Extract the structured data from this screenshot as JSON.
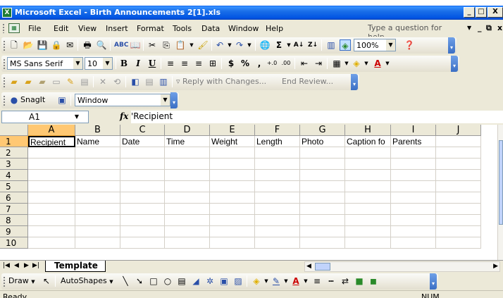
{
  "window": {
    "title": "Microsoft Excel - Birth Announcements 2[1].xls",
    "app_icon": "excel-icon"
  },
  "menu": {
    "items": [
      "File",
      "Edit",
      "View",
      "Insert",
      "Format",
      "Tools",
      "Data",
      "Window",
      "Help"
    ],
    "question_placeholder": "Type a question for help"
  },
  "standard_toolbar": {
    "zoom": "100%"
  },
  "formatting_toolbar": {
    "font": "MS Sans Serif",
    "size": "10",
    "bold": "B",
    "italic": "I",
    "underline": "U",
    "currency": "$",
    "percent": "%",
    "comma": ","
  },
  "reviewing_toolbar": {
    "reply": "Reply with Changes...",
    "end_review": "End Review..."
  },
  "snagit_toolbar": {
    "snagit_label": "SnagIt",
    "window_value": "Window"
  },
  "formula_bar": {
    "name_box": "A1",
    "fx": "fx",
    "content": "'Recipient"
  },
  "grid": {
    "columns": [
      "A",
      "B",
      "C",
      "D",
      "E",
      "F",
      "G",
      "H",
      "I",
      "J"
    ],
    "rows": [
      "1",
      "2",
      "3",
      "4",
      "5",
      "6",
      "7",
      "8",
      "9",
      "10"
    ],
    "row1": [
      "Recipient",
      "Name",
      "Date",
      "Time",
      "Weight",
      "Length",
      "Photo",
      "Caption fo",
      "Parents",
      ""
    ],
    "active_cell": "A1"
  },
  "sheet_tabs": {
    "active": "Template"
  },
  "draw_toolbar": {
    "draw": "Draw",
    "autoshapes": "AutoShapes"
  },
  "status": {
    "left": "Ready",
    "num": "NUM"
  },
  "colors": {
    "title_bar": "#0054e3",
    "selection_header": "#ffc873",
    "chrome": "#ece9d8"
  }
}
